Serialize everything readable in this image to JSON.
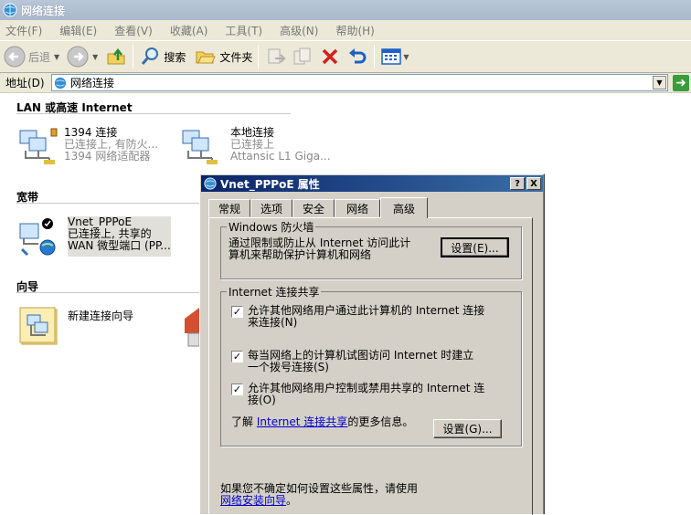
{
  "window": {
    "title": "网络连接"
  },
  "menu": [
    "文件(F)",
    "编辑(E)",
    "查看(V)",
    "收藏(A)",
    "工具(T)",
    "高级(N)",
    "帮助(H)"
  ],
  "toolbar": {
    "back": "后退",
    "search": "搜索",
    "folders": "文件夹"
  },
  "address": {
    "label": "地址(D)",
    "value": "网络连接"
  },
  "groups": {
    "lan": "LAN 或高速 Internet",
    "broadband": "宽带",
    "wizard": "向导"
  },
  "connections": {
    "c1394": {
      "name": "1394 连接",
      "status": "已连接上, 有防火...",
      "device": "1394 网络适配器"
    },
    "local": {
      "name": "本地连接",
      "status": "已连接上",
      "device": "Attansic L1 Giga..."
    },
    "pppoe": {
      "name": "Vnet_PPPoE",
      "status": "已连接上, 共享的",
      "device": "WAN 微型端口 (PP..."
    },
    "wizard": {
      "name": "新建连接向导"
    }
  },
  "dialog": {
    "title": "Vnet_PPPoE 属性",
    "help_btn": "?",
    "close_btn": "X",
    "tabs": [
      "常规",
      "选项",
      "安全",
      "网络",
      "高级"
    ],
    "firewall": {
      "legend": "Windows 防火墙",
      "text_line1": "通过限制或防止从 Internet 访问此计",
      "text_line2": "算机来帮助保护计算机和网络",
      "settings_btn": "设置(E)..."
    },
    "ics": {
      "legend": "Internet 连接共享",
      "cb1_line1": "允许其他网络用户通过此计算机的 Internet 连接",
      "cb1_line2": "来连接(N)",
      "cb2_line1": "每当网络上的计算机试图访问 Internet 时建立",
      "cb2_line2": "一个拨号连接(S)",
      "cb3_line1": "允许其他网络用户控制或禁用共享的 Internet 连",
      "cb3_line2": "接(O)",
      "learn_prefix": "了解",
      "learn_link": "Internet 连接共享",
      "learn_suffix": "的更多信息。",
      "settings_btn": "设置(G)..."
    },
    "footer_line1": "如果您不确定如何设置这些属性，请使用",
    "footer_link": "网络安装向导",
    "footer_suffix": "。"
  }
}
